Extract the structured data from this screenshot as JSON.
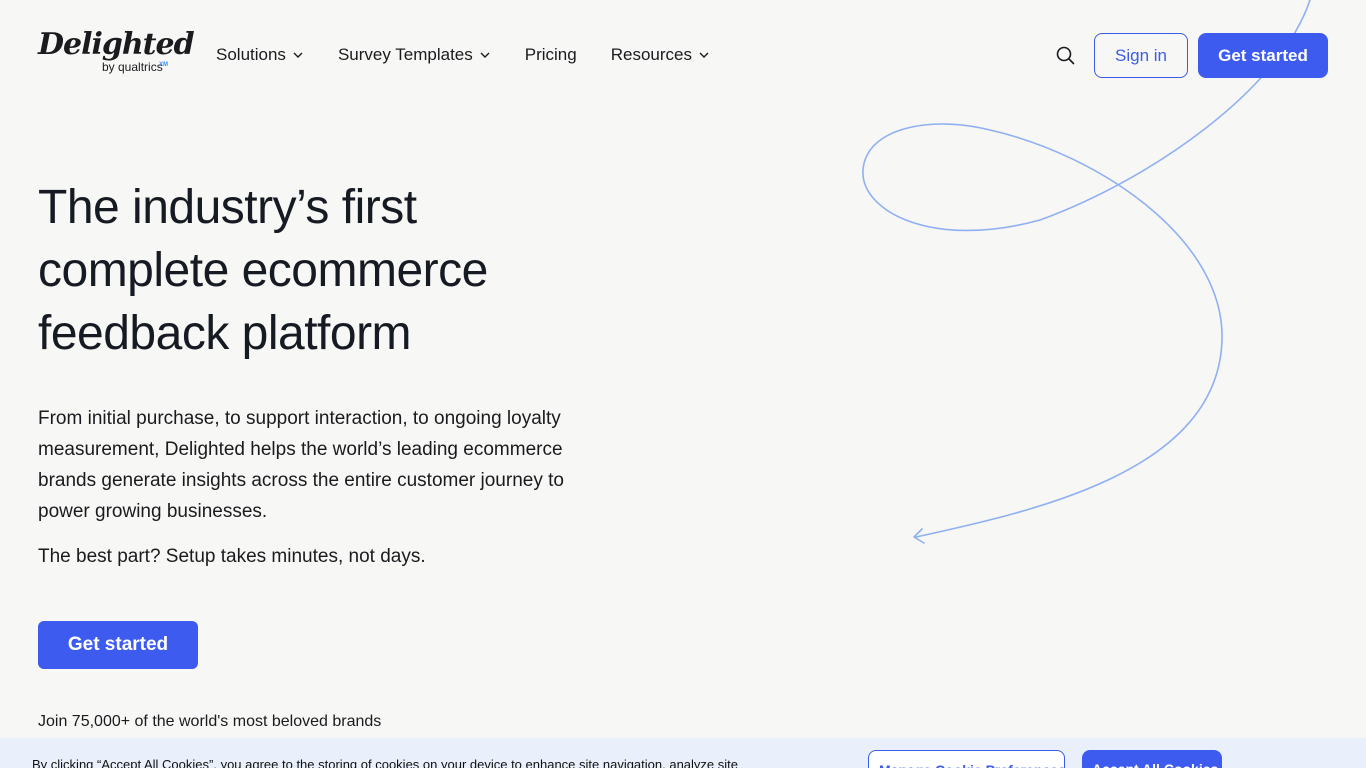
{
  "header": {
    "logo": {
      "wordmark": "Delighted",
      "sub": "by qualtrics",
      "xm": "XM"
    },
    "nav": {
      "solutions": "Solutions",
      "survey_templates": "Survey Templates",
      "pricing": "Pricing",
      "resources": "Resources"
    },
    "sign_in": "Sign in",
    "get_started": "Get started"
  },
  "hero": {
    "title_line1": "The industry’s first",
    "title_line2": "complete ecommerce",
    "title_line3": "feedback platform",
    "description": "From initial purchase, to support interaction, to ongoing loyalty measurement, Delighted helps the world’s leading ecommerce brands generate insights across the entire customer journey to power growing businesses.",
    "tagline": "The best part? Setup takes minutes, not days.",
    "cta": "Get started",
    "brands_line": "Join 75,000+ of the world's most beloved brands"
  },
  "cookie_banner": {
    "text": "By clicking “Accept All Cookies”, you agree to the storing of cookies on your device to enhance site navigation, analyze site",
    "manage_label": "Manage Cookie Preferences",
    "accept_label": "Accept All Cookies"
  },
  "colors": {
    "background": "#f7f7f5",
    "primary": "#3e5bf0",
    "swirl": "#8fb0f2",
    "cookie_bg": "#e9f0fb",
    "text": "#16161d"
  }
}
